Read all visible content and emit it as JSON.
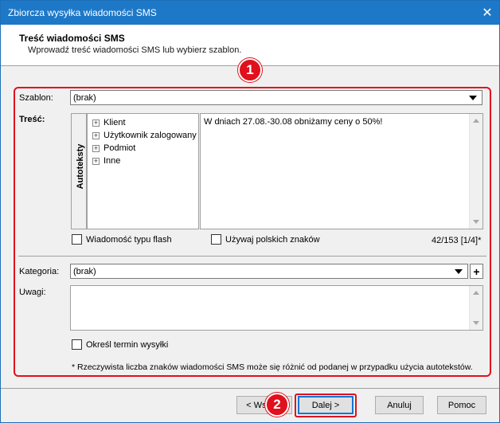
{
  "window": {
    "title": "Zbiorcza wysyłka wiadomości SMS",
    "close_glyph": "✕"
  },
  "header": {
    "title": "Treść wiadomości SMS",
    "subtitle": "Wprowadź treść wiadomości SMS lub wybierz szablon."
  },
  "annotations": {
    "badge1": "1",
    "badge2": "2",
    "accent_color": "#e0101c"
  },
  "form": {
    "szablon_label": "Szablon:",
    "szablon_value": "(brak)",
    "tresc_label": "Treść:",
    "autoteksty_label": "Autoteksty",
    "tree_items": [
      "Klient",
      "Użytkownik zalogowany",
      "Podmiot",
      "Inne"
    ],
    "message_text": "W dniach 27.08.-30.08 obniżamy ceny o 50%!",
    "flash_label": "Wiadomość typu flash",
    "polish_label": "Używaj polskich znaków",
    "char_count": "42/153 [1/4]*",
    "kategoria_label": "Kategoria:",
    "kategoria_value": "(brak)",
    "add_glyph": "+",
    "uwagi_label": "Uwagi:",
    "termin_label": "Określ termin wysyłki",
    "footnote": "* Rzeczywista liczba znaków wiadomości SMS może się różnić od podanej w przypadku użycia autotekstów."
  },
  "buttons": {
    "back": "< Wstecz",
    "next": "Dalej >",
    "cancel": "Anuluj",
    "help": "Pomoc"
  }
}
